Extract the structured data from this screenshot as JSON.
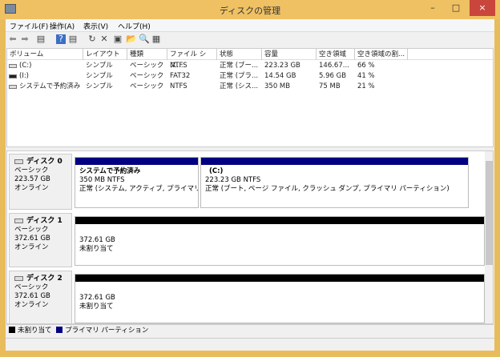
{
  "window": {
    "title": "ディスクの管理",
    "minimize": "–",
    "maximize": "□",
    "close": "×"
  },
  "menu": [
    "ファイル(F)",
    "操作(A)",
    "表示(V)",
    "ヘルプ(H)"
  ],
  "toolbar": [
    {
      "icon": "back-icon",
      "g": "⬅"
    },
    {
      "icon": "forward-icon",
      "g": "➡"
    },
    {
      "icon": "console-tree-icon",
      "g": "▤"
    },
    {
      "icon": "help-icon",
      "g": "?"
    },
    {
      "icon": "action-pane-icon",
      "g": "▤"
    },
    {
      "icon": "refresh-icon",
      "g": "↻"
    },
    {
      "icon": "delete-icon",
      "g": "✕"
    },
    {
      "icon": "properties-icon",
      "g": "▣"
    },
    {
      "icon": "open-icon",
      "g": "📂"
    },
    {
      "icon": "search-icon",
      "g": "🔍"
    },
    {
      "icon": "settings-icon",
      "g": "▦"
    }
  ],
  "columns": [
    "ボリューム",
    "レイアウト",
    "種類",
    "ファイル シス...",
    "状態",
    "容量",
    "空き領域",
    "空き領域の割..."
  ],
  "volumes": [
    [
      "(C:)",
      "シンプル",
      "ベーシック",
      "NTFS",
      "正常 (ブー...",
      "223.23 GB",
      "146.67...",
      "66 %"
    ],
    [
      "(I:)",
      "シンプル",
      "ベーシック",
      "FAT32",
      "正常 (プラ...",
      "14.54 GB",
      "5.96 GB",
      "41 %"
    ],
    [
      "システムで予約済み",
      "シンプル",
      "ベーシック",
      "NTFS",
      "正常 (シス...",
      "350 MB",
      "75 MB",
      "21 %"
    ]
  ],
  "disks": [
    {
      "name": "ディスク 0",
      "type": "ベーシック",
      "size": "223.57 GB",
      "status": "オンライン",
      "parts": [
        {
          "title": "システムで予約済み",
          "size": "350 MB NTFS",
          "status": "正常 (システム, アクティブ, プライマリ パーテ",
          "color": "#000080"
        },
        {
          "title": "(C:)",
          "size": "223.23 GB NTFS",
          "status": "正常 (ブート, ページ ファイル, クラッシュ ダンプ, プライマリ パーティション)",
          "color": "#000080"
        }
      ]
    },
    {
      "name": "ディスク 1",
      "type": "ベーシック",
      "size": "372.61 GB",
      "status": "オンライン",
      "parts": [
        {
          "title": "",
          "size": "372.61 GB",
          "status": "未割り当て",
          "color": "#000000"
        }
      ]
    },
    {
      "name": "ディスク 2",
      "type": "ベーシック",
      "size": "372.61 GB",
      "status": "オンライン",
      "parts": [
        {
          "title": "",
          "size": "372.61 GB",
          "status": "未割り当て",
          "color": "#000000"
        }
      ]
    }
  ],
  "legend": [
    {
      "label": "未割り当て",
      "color": "#000000"
    },
    {
      "label": "プライマリ パーティション",
      "color": "#000080"
    }
  ]
}
